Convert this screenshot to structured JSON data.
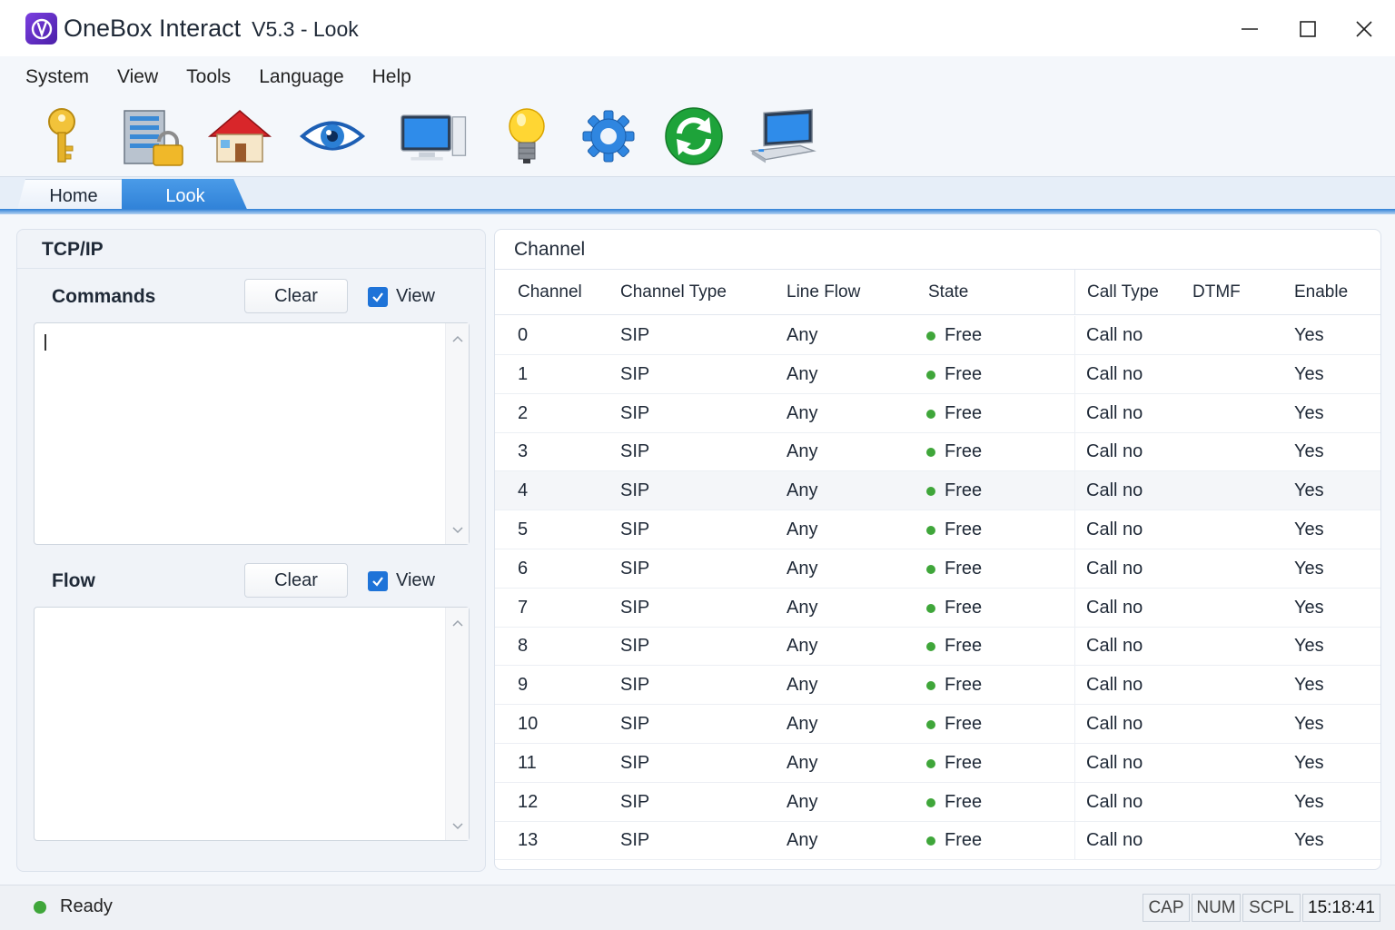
{
  "window": {
    "title": "OneBox Interact",
    "version": "V5.3 - Look"
  },
  "menu": [
    "System",
    "View",
    "Tools",
    "Language",
    "Help"
  ],
  "toolbar": {
    "icons": [
      "key-icon",
      "server-lock-icon",
      "home-icon",
      "eye-icon",
      "monitor-icon",
      "lightbulb-icon",
      "gear-icon",
      "refresh-icon",
      "laptop-icon"
    ]
  },
  "tabs": {
    "home": "Home",
    "look": "Look",
    "active": "Look"
  },
  "left_panel": {
    "title": "TCP/IP",
    "commands": {
      "label": "Commands",
      "clear": "Clear",
      "view": "View",
      "view_checked": true,
      "text": ""
    },
    "flow": {
      "label": "Flow",
      "clear": "Clear",
      "view": "View",
      "view_checked": true,
      "text": ""
    }
  },
  "channel": {
    "title": "Channel",
    "columns": [
      "Channel",
      "Channel Type",
      "Line Flow",
      "State",
      "Call Type",
      "DTMF",
      "Enable"
    ],
    "rows": [
      {
        "channel": "0",
        "type": "SIP",
        "flow": "Any",
        "state": "Free",
        "call_type": "Call no",
        "dtmf": "",
        "enable": "Yes"
      },
      {
        "channel": "1",
        "type": "SIP",
        "flow": "Any",
        "state": "Free",
        "call_type": "Call no",
        "dtmf": "",
        "enable": "Yes"
      },
      {
        "channel": "2",
        "type": "SIP",
        "flow": "Any",
        "state": "Free",
        "call_type": "Call no",
        "dtmf": "",
        "enable": "Yes"
      },
      {
        "channel": "3",
        "type": "SIP",
        "flow": "Any",
        "state": "Free",
        "call_type": "Call no",
        "dtmf": "",
        "enable": "Yes"
      },
      {
        "channel": "4",
        "type": "SIP",
        "flow": "Any",
        "state": "Free",
        "call_type": "Call no",
        "dtmf": "",
        "enable": "Yes"
      },
      {
        "channel": "5",
        "type": "SIP",
        "flow": "Any",
        "state": "Free",
        "call_type": "Call no",
        "dtmf": "",
        "enable": "Yes"
      },
      {
        "channel": "6",
        "type": "SIP",
        "flow": "Any",
        "state": "Free",
        "call_type": "Call no",
        "dtmf": "",
        "enable": "Yes"
      },
      {
        "channel": "7",
        "type": "SIP",
        "flow": "Any",
        "state": "Free",
        "call_type": "Call no",
        "dtmf": "",
        "enable": "Yes"
      },
      {
        "channel": "8",
        "type": "SIP",
        "flow": "Any",
        "state": "Free",
        "call_type": "Call no",
        "dtmf": "",
        "enable": "Yes"
      },
      {
        "channel": "9",
        "type": "SIP",
        "flow": "Any",
        "state": "Free",
        "call_type": "Call no",
        "dtmf": "",
        "enable": "Yes"
      },
      {
        "channel": "10",
        "type": "SIP",
        "flow": "Any",
        "state": "Free",
        "call_type": "Call no",
        "dtmf": "",
        "enable": "Yes"
      },
      {
        "channel": "11",
        "type": "SIP",
        "flow": "Any",
        "state": "Free",
        "call_type": "Call no",
        "dtmf": "",
        "enable": "Yes"
      },
      {
        "channel": "12",
        "type": "SIP",
        "flow": "Any",
        "state": "Free",
        "call_type": "Call no",
        "dtmf": "",
        "enable": "Yes"
      },
      {
        "channel": "13",
        "type": "SIP",
        "flow": "Any",
        "state": "Free",
        "call_type": "Call no",
        "dtmf": "",
        "enable": "Yes"
      }
    ],
    "highlighted_row": 4
  },
  "status": {
    "text": "Ready",
    "cap": "CAP",
    "num": "NUM",
    "scrl": "SCPL",
    "time": "15:18:41"
  },
  "colors": {
    "accent": "#2d7fd6",
    "free_state": "#3fa63a",
    "logo": "#6a30d0"
  }
}
